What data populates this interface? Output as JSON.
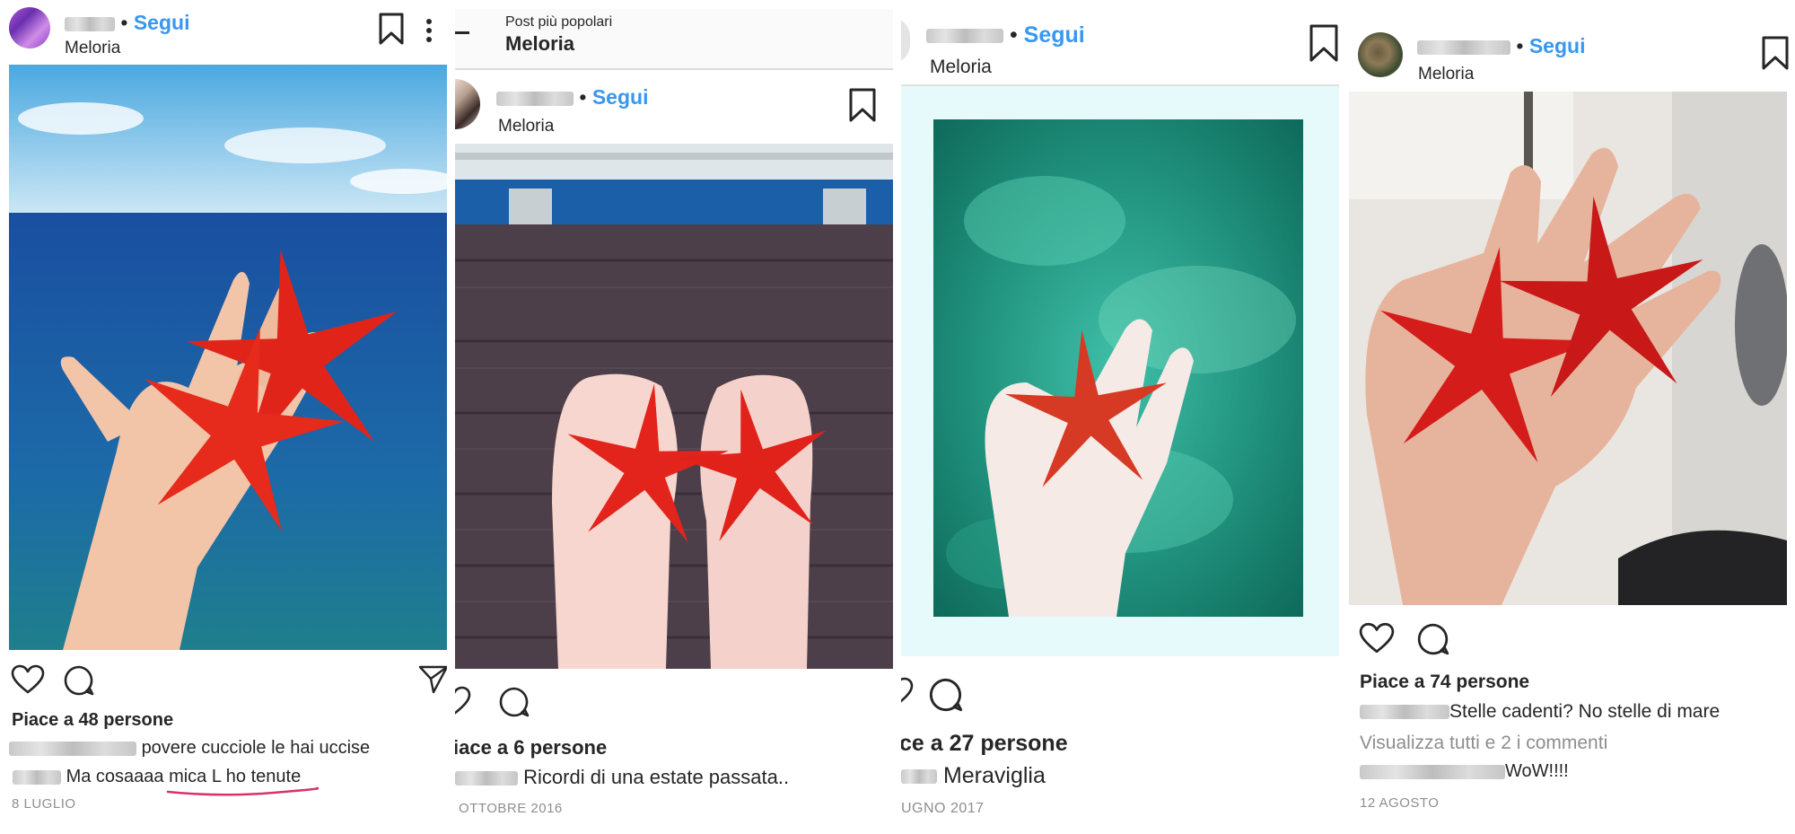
{
  "colors": {
    "link": "#3897f0",
    "text": "#262626",
    "muted": "#8e8e8e",
    "underline": "#d6336c"
  },
  "icons": [
    "bookmark-icon",
    "more-icon",
    "heart-icon",
    "comment-icon",
    "share-icon",
    "back-icon"
  ],
  "common": {
    "follow_label": "Segui",
    "location": "Meloria"
  },
  "post1": {
    "likes": "Piace a 48 persone",
    "comment1": "povere cucciole le hai uccise",
    "comment2_prefix": "Ma cosaaaa ",
    "comment2_highlight": "mica L ho tenute",
    "date": "8 LUGLIO"
  },
  "post2": {
    "header_subtitle": "Post più popolari",
    "header_title": "Meloria",
    "likes": "iace a 6 persone",
    "comment1": "Ricordi di una estate passata..",
    "date": "OTTOBRE 2016"
  },
  "post3": {
    "likes": "ce a 27 persone",
    "comment1": "Meraviglia",
    "date": "UGNO 2017"
  },
  "post4": {
    "likes": "Piace a 74 persone",
    "comment1": "Stelle cadenti? No stelle di mare",
    "view_all": "Visualizza tutti e 2 i commenti",
    "comment2": "WoW!!!!",
    "date": "12 AGOSTO"
  }
}
